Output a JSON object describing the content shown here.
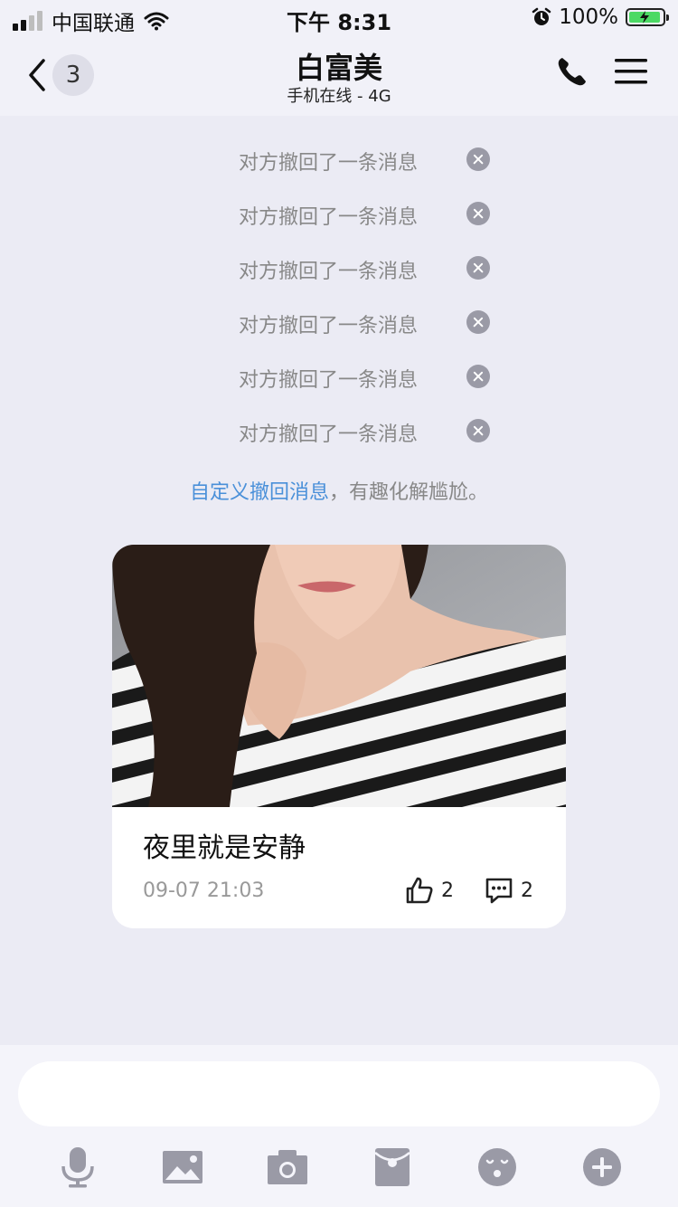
{
  "status": {
    "carrier": "中国联通",
    "time": "下午 8:31",
    "battery": "100%"
  },
  "header": {
    "back_count": "3",
    "title": "白富美",
    "subtitle": "手机在线 - 4G"
  },
  "recalls": [
    "对方撤回了一条消息",
    "对方撤回了一条消息",
    "对方撤回了一条消息",
    "对方撤回了一条消息",
    "对方撤回了一条消息",
    "对方撤回了一条消息"
  ],
  "tip": {
    "link": "自定义撤回消息",
    "rest": "，有趣化解尴尬。"
  },
  "card": {
    "title": "夜里就是安静",
    "time": "09-07 21:03",
    "likes": "2",
    "comments": "2"
  },
  "input": {
    "placeholder": ""
  },
  "toolbar": [
    "mic-icon",
    "image-icon",
    "camera-icon",
    "red-packet-icon",
    "emoji-icon",
    "plus-icon"
  ]
}
